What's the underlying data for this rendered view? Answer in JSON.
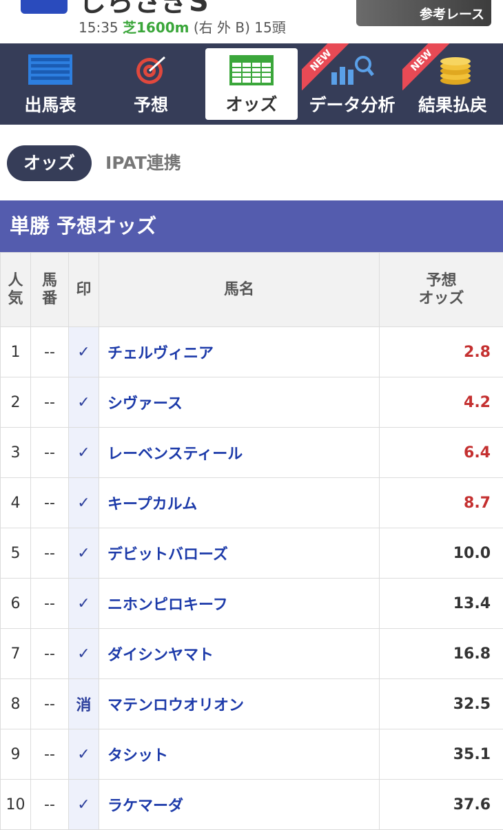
{
  "race": {
    "name": "しらさぎS",
    "time": "15:35",
    "surface": "芝1600m",
    "course": "(右 外 B)",
    "runners": "15頭",
    "reference_label": "参考レース"
  },
  "nav": {
    "tabs": [
      {
        "label": "出馬表",
        "icon": "race-card-icon",
        "active": false,
        "new": false
      },
      {
        "label": "予想",
        "icon": "target-icon",
        "active": false,
        "new": false
      },
      {
        "label": "オッズ",
        "icon": "odds-table-icon",
        "active": true,
        "new": false
      },
      {
        "label": "データ分析",
        "icon": "chart-search-icon",
        "active": false,
        "new": true
      },
      {
        "label": "結果払戻",
        "icon": "coins-icon",
        "active": false,
        "new": true
      }
    ],
    "new_badge": "NEW"
  },
  "subtabs": {
    "active": "オッズ",
    "other": "IPAT連携"
  },
  "section": {
    "title": "単勝 予想オッズ"
  },
  "table": {
    "headers": {
      "rank": "人気",
      "number": "馬番",
      "mark": "印",
      "name": "馬名",
      "odds": "予想オッズ"
    },
    "rows": [
      {
        "rank": "1",
        "number": "--",
        "mark": "✓",
        "name": "チェルヴィニア",
        "odds": "2.8",
        "hot": true
      },
      {
        "rank": "2",
        "number": "--",
        "mark": "✓",
        "name": "シヴァース",
        "odds": "4.2",
        "hot": true
      },
      {
        "rank": "3",
        "number": "--",
        "mark": "✓",
        "name": "レーベンスティール",
        "odds": "6.4",
        "hot": true
      },
      {
        "rank": "4",
        "number": "--",
        "mark": "✓",
        "name": "キープカルム",
        "odds": "8.7",
        "hot": true
      },
      {
        "rank": "5",
        "number": "--",
        "mark": "✓",
        "name": "デビットバローズ",
        "odds": "10.0",
        "hot": false
      },
      {
        "rank": "6",
        "number": "--",
        "mark": "✓",
        "name": "ニホンピロキーフ",
        "odds": "13.4",
        "hot": false
      },
      {
        "rank": "7",
        "number": "--",
        "mark": "✓",
        "name": "ダイシンヤマト",
        "odds": "16.8",
        "hot": false
      },
      {
        "rank": "8",
        "number": "--",
        "mark": "消",
        "name": "マテンロウオリオン",
        "odds": "32.5",
        "hot": false
      },
      {
        "rank": "9",
        "number": "--",
        "mark": "✓",
        "name": "タシット",
        "odds": "35.1",
        "hot": false
      },
      {
        "rank": "10",
        "number": "--",
        "mark": "✓",
        "name": "ラケマーダ",
        "odds": "37.6",
        "hot": false
      }
    ]
  },
  "colors": {
    "nav_bg": "#363d58",
    "section_bg": "#545cae",
    "hot_odds": "#c43030",
    "horse_name": "#1c3aa9",
    "surface": "#3aa63a"
  }
}
